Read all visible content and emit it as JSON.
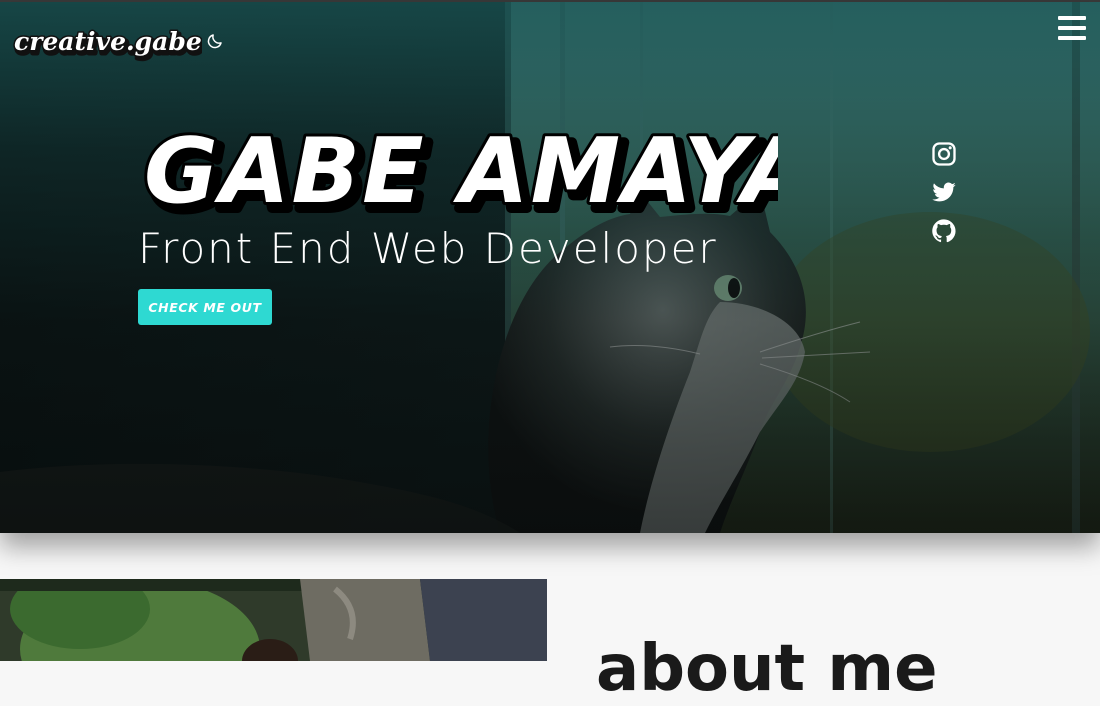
{
  "brand": {
    "logo_text": "creative.gabe",
    "theme_toggle_icon": "moon-icon",
    "menu_icon": "hamburger-menu-icon"
  },
  "hero": {
    "name": "GABE AMAYA",
    "subtitle": "Front End Web Developer",
    "cta_label": "CHECK ME OUT",
    "background_image": "photo of a cat looking out a window",
    "social_links": [
      {
        "icon": "instagram-icon"
      },
      {
        "icon": "twitter-icon"
      },
      {
        "icon": "github-icon"
      }
    ]
  },
  "about": {
    "heading": "about me",
    "photo": "portrait photo outdoors next to a tree"
  },
  "colors": {
    "accent": "#2ed9d2",
    "hero_top_tint": "#184e4e",
    "hero_bottom": "#050707",
    "text_light": "#ffffff",
    "page_bg": "#f7f7f7"
  }
}
